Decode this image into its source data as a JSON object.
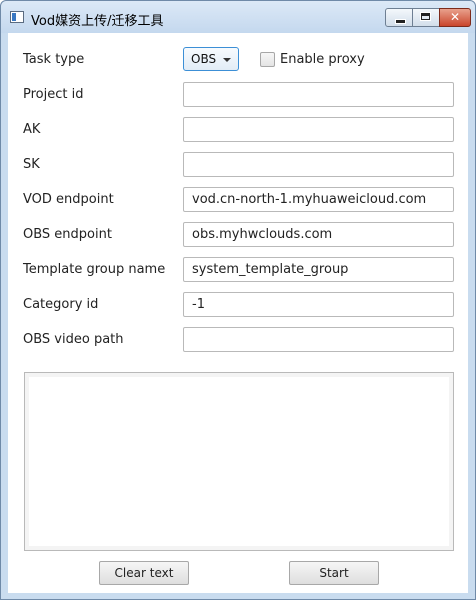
{
  "window": {
    "title": "Vod媒资上传/迁移工具",
    "controls": {
      "close_glyph": "✕"
    }
  },
  "form": {
    "task_type": {
      "label": "Task type",
      "selected": "OBS"
    },
    "enable_proxy": {
      "label": "Enable proxy",
      "checked": false
    },
    "project_id": {
      "label": "Project id",
      "value": ""
    },
    "ak": {
      "label": "AK",
      "value": ""
    },
    "sk": {
      "label": "SK",
      "value": ""
    },
    "vod_endpoint": {
      "label": "VOD endpoint",
      "value": "vod.cn-north-1.myhuaweicloud.com"
    },
    "obs_endpoint": {
      "label": "OBS endpoint",
      "value": "obs.myhwclouds.com"
    },
    "template_group_name": {
      "label": "Template group name",
      "value": "system_template_group"
    },
    "category_id": {
      "label": "Category id",
      "value": "-1"
    },
    "obs_video_path": {
      "label": "OBS video path",
      "value": ""
    }
  },
  "output": {
    "text": ""
  },
  "buttons": {
    "clear_text": "Clear text",
    "start": "Start"
  },
  "colors": {
    "focus_accent": "#3c8fd6",
    "close_button": "#c9462c",
    "titlebar": "#c4d8ee"
  }
}
